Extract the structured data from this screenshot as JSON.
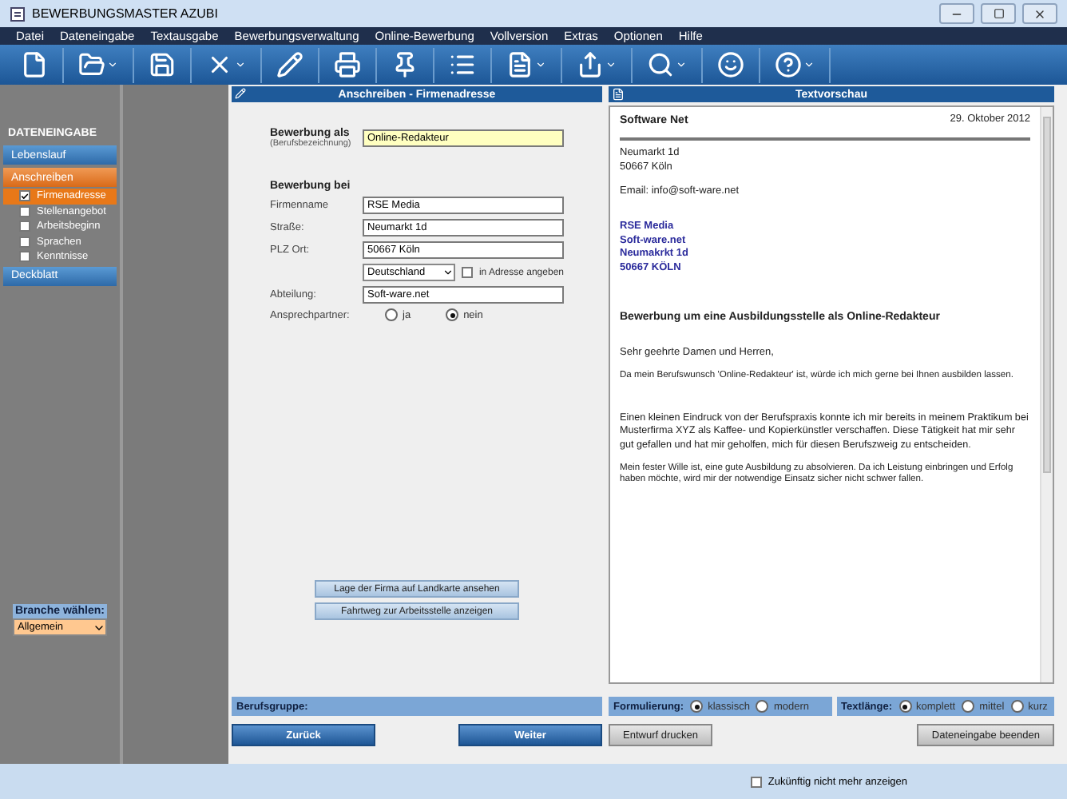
{
  "window": {
    "title": "BEWERBUNGSMASTER AZUBI"
  },
  "menu": [
    "Datei",
    "Dateneingabe",
    "Textausgabe",
    "Bewerbungsverwaltung",
    "Online-Bewerbung",
    "Vollversion",
    "Extras",
    "Optionen",
    "Hilfe"
  ],
  "sidebar": {
    "heading": "DATENEINGABE",
    "sections": [
      {
        "label": "Lebenslauf",
        "selected": false
      },
      {
        "label": "Anschreiben",
        "selected": true,
        "items": [
          {
            "label": "Firmenadresse",
            "checked": true,
            "selected": true
          },
          {
            "label": "Stellenangebot",
            "checked": false,
            "selected": false
          },
          {
            "label": "Arbeitsbeginn",
            "checked": false,
            "selected": false
          },
          {
            "label": "Sprachen",
            "checked": false,
            "selected": false
          },
          {
            "label": "Kenntnisse",
            "checked": false,
            "selected": false
          }
        ]
      },
      {
        "label": "Deckblatt",
        "selected": false
      }
    ],
    "branche": {
      "label": "Branche wählen:",
      "value": "Allgemein"
    }
  },
  "form": {
    "title": "Anschreiben - Firmenadresse",
    "position": {
      "label": "Bewerbung als",
      "hint": "(Berufsbezeichnung)",
      "value": "Online-Redakteur"
    },
    "company_heading": "Bewerbung bei",
    "fields": [
      {
        "label": "Firmenname",
        "value": "RSE Media"
      },
      {
        "label": "Straße:",
        "value": "Neumarkt 1d"
      },
      {
        "label": "PLZ Ort:",
        "value": "50667 Köln"
      }
    ],
    "country": {
      "value": "Deutschland"
    },
    "show_in_address": {
      "label": "in Adresse angeben",
      "checked": false
    },
    "department": {
      "label": "Abteilung:",
      "value": "Soft-ware.net"
    },
    "contact": {
      "label": "Ansprechpartner:",
      "options": [
        {
          "label": "ja",
          "selected": false
        },
        {
          "label": "nein",
          "selected": true
        }
      ]
    },
    "buttons": [
      "Lage der Firma auf Landkarte ansehen",
      "Fahrtweg zur Arbeitsstelle anzeigen"
    ]
  },
  "preview": {
    "title": "Textvorschau",
    "sender": "Software Net",
    "date": "29. Oktober 2012",
    "sender_address": [
      "Neumarkt 1d",
      "50667 Köln"
    ],
    "email": "Email: info@soft-ware.net",
    "recipient": [
      "RSE Media",
      "Soft-ware.net",
      "Neumakrkt 1d",
      "50667 KÖLN"
    ],
    "subject": "Bewerbung um eine Ausbildungsstelle als Online-Redakteur",
    "salutation": "Sehr geehrte Damen und Herren,",
    "paragraphs": [
      "Da mein Berufswunsch 'Online-Redakteur' ist, würde ich mich gerne bei Ihnen ausbilden lassen.",
      "Einen kleinen Eindruck von der Berufspraxis konnte ich mir bereits in meinem Praktikum bei Musterfirma XYZ als Kaffee- und Kopierkünstler verschaffen. Diese Tätigkeit hat mir sehr gut gefallen und hat mir geholfen, mich für diesen Berufszweig zu entscheiden.",
      "Mein fester Wille ist, eine gute Ausbildung zu absolvieren. Da ich Leistung einbringen und Erfolg haben möchte, wird mir der notwendige Einsatz sicher nicht schwer fallen."
    ]
  },
  "options_bar": {
    "group_label": "Berufsgruppe:",
    "wording": {
      "label": "Formulierung:",
      "options": [
        {
          "label": "klassisch",
          "selected": true
        },
        {
          "label": "modern",
          "selected": false
        }
      ]
    },
    "length": {
      "label": "Textlänge:",
      "options": [
        {
          "label": "komplett",
          "selected": true
        },
        {
          "label": "mittel",
          "selected": false
        },
        {
          "label": "kurz",
          "selected": false
        }
      ]
    }
  },
  "buttons": [
    {
      "label": "Zurück",
      "kind": "primary"
    },
    {
      "label": "Weiter",
      "kind": "primary"
    },
    {
      "label": "Entwurf drucken",
      "kind": "secondary"
    },
    {
      "label": "Dateneingabe beenden",
      "kind": "secondary"
    }
  ],
  "footer": {
    "dont_show": {
      "label": "Zukünftig nicht mehr anzeigen",
      "checked": false
    }
  }
}
